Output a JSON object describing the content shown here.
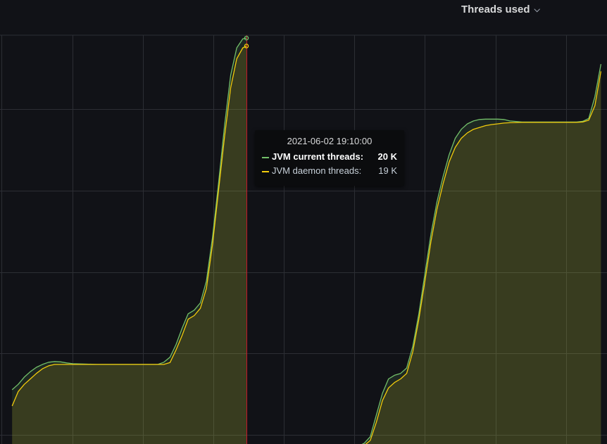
{
  "panel": {
    "title": "Threads used",
    "menu_icon": "chevron-down-icon"
  },
  "tooltip": {
    "time": "2021-06-02 19:10:00",
    "rows": [
      {
        "name": "JVM current threads:",
        "value": "20 K",
        "color": "#73bf69"
      },
      {
        "name": "JVM daemon threads:",
        "value": "19 K",
        "color": "#f2cc0c"
      }
    ]
  },
  "chart_data": {
    "type": "area",
    "xlabel": "",
    "ylabel": "",
    "x_range": [
      0,
      100
    ],
    "ylim": [
      9500,
      20800
    ],
    "crosshair_x": 40.6,
    "grid": true,
    "legend": "none",
    "series": [
      {
        "name": "JVM current threads",
        "color": "#73bf69",
        "points": [
          [
            2,
            11000
          ],
          [
            3,
            11150
          ],
          [
            4,
            11350
          ],
          [
            5,
            11500
          ],
          [
            6,
            11620
          ],
          [
            7,
            11700
          ],
          [
            8,
            11760
          ],
          [
            9,
            11780
          ],
          [
            10,
            11770
          ],
          [
            11,
            11740
          ],
          [
            12,
            11720
          ],
          [
            14,
            11710
          ],
          [
            16,
            11700
          ],
          [
            18,
            11700
          ],
          [
            20,
            11700
          ],
          [
            22,
            11700
          ],
          [
            24,
            11700
          ],
          [
            26,
            11700
          ],
          [
            27,
            11760
          ],
          [
            28,
            11900
          ],
          [
            29,
            12250
          ],
          [
            30,
            12700
          ],
          [
            31,
            13100
          ],
          [
            32,
            13200
          ],
          [
            33,
            13400
          ],
          [
            34,
            14000
          ],
          [
            35,
            15200
          ],
          [
            36,
            16700
          ],
          [
            37,
            18300
          ],
          [
            38,
            19700
          ],
          [
            39,
            20450
          ],
          [
            40,
            20700
          ],
          [
            40.6,
            20720
          ]
        ]
      },
      {
        "name": "JVM current threads",
        "color": "#73bf69",
        "points": [
          [
            42.6,
            9350
          ],
          [
            44,
            9450
          ],
          [
            45,
            9470
          ],
          [
            46,
            9430
          ],
          [
            47,
            9440
          ],
          [
            48,
            9420
          ],
          [
            50,
            9410
          ],
          [
            52,
            9410
          ],
          [
            54,
            9410
          ],
          [
            56,
            9410
          ],
          [
            58,
            9410
          ],
          [
            59,
            9440
          ],
          [
            60,
            9520
          ],
          [
            61,
            9700
          ],
          [
            62,
            10300
          ],
          [
            63,
            10900
          ],
          [
            64,
            11300
          ],
          [
            65,
            11400
          ],
          [
            66,
            11450
          ],
          [
            67,
            11600
          ],
          [
            68,
            12200
          ],
          [
            69,
            13100
          ],
          [
            70,
            14200
          ],
          [
            71,
            15300
          ],
          [
            72,
            16200
          ],
          [
            73,
            16900
          ],
          [
            74,
            17500
          ],
          [
            75,
            17950
          ],
          [
            76,
            18200
          ],
          [
            77,
            18350
          ],
          [
            78,
            18430
          ],
          [
            79,
            18470
          ],
          [
            80,
            18480
          ],
          [
            81,
            18480
          ],
          [
            82,
            18480
          ],
          [
            83,
            18470
          ],
          [
            84,
            18430
          ],
          [
            86,
            18400
          ],
          [
            88,
            18400
          ],
          [
            90,
            18400
          ],
          [
            92,
            18400
          ],
          [
            94,
            18400
          ],
          [
            95,
            18400
          ],
          [
            96,
            18420
          ],
          [
            97,
            18500
          ],
          [
            98,
            19100
          ],
          [
            99,
            20000
          ]
        ]
      },
      {
        "name": "JVM daemon threads",
        "color": "#f2cc0c",
        "points": [
          [
            2,
            10550
          ],
          [
            3,
            10950
          ],
          [
            4,
            11150
          ],
          [
            5,
            11300
          ],
          [
            6,
            11450
          ],
          [
            7,
            11580
          ],
          [
            8,
            11660
          ],
          [
            9,
            11700
          ],
          [
            10,
            11700
          ],
          [
            12,
            11700
          ],
          [
            14,
            11700
          ],
          [
            16,
            11700
          ],
          [
            18,
            11700
          ],
          [
            20,
            11700
          ],
          [
            22,
            11700
          ],
          [
            24,
            11700
          ],
          [
            26,
            11700
          ],
          [
            27,
            11700
          ],
          [
            28,
            11750
          ],
          [
            29,
            12100
          ],
          [
            30,
            12500
          ],
          [
            31,
            12950
          ],
          [
            32,
            13050
          ],
          [
            33,
            13250
          ],
          [
            34,
            13800
          ],
          [
            35,
            15000
          ],
          [
            36,
            16500
          ],
          [
            37,
            18000
          ],
          [
            38,
            19350
          ],
          [
            39,
            20150
          ],
          [
            40,
            20450
          ],
          [
            40.6,
            20500
          ]
        ]
      },
      {
        "name": "JVM daemon threads",
        "color": "#f2cc0c",
        "points": [
          [
            44,
            9320
          ],
          [
            45,
            9360
          ],
          [
            46,
            9380
          ],
          [
            48,
            9390
          ],
          [
            50,
            9395
          ],
          [
            52,
            9395
          ],
          [
            54,
            9395
          ],
          [
            56,
            9395
          ],
          [
            58,
            9400
          ],
          [
            59,
            9410
          ],
          [
            60,
            9460
          ],
          [
            61,
            9600
          ],
          [
            62,
            10100
          ],
          [
            63,
            10700
          ],
          [
            64,
            11050
          ],
          [
            65,
            11200
          ],
          [
            66,
            11300
          ],
          [
            67,
            11450
          ],
          [
            68,
            12050
          ],
          [
            69,
            12950
          ],
          [
            70,
            14000
          ],
          [
            71,
            15100
          ],
          [
            72,
            16000
          ],
          [
            73,
            16700
          ],
          [
            74,
            17300
          ],
          [
            75,
            17700
          ],
          [
            76,
            17950
          ],
          [
            77,
            18100
          ],
          [
            78,
            18200
          ],
          [
            79,
            18250
          ],
          [
            80,
            18300
          ],
          [
            81,
            18330
          ],
          [
            82,
            18350
          ],
          [
            83,
            18370
          ],
          [
            84,
            18380
          ],
          [
            86,
            18390
          ],
          [
            88,
            18390
          ],
          [
            90,
            18390
          ],
          [
            92,
            18390
          ],
          [
            94,
            18390
          ],
          [
            95,
            18390
          ],
          [
            96,
            18400
          ],
          [
            97,
            18450
          ],
          [
            98,
            18850
          ],
          [
            99,
            19800
          ]
        ]
      }
    ]
  }
}
